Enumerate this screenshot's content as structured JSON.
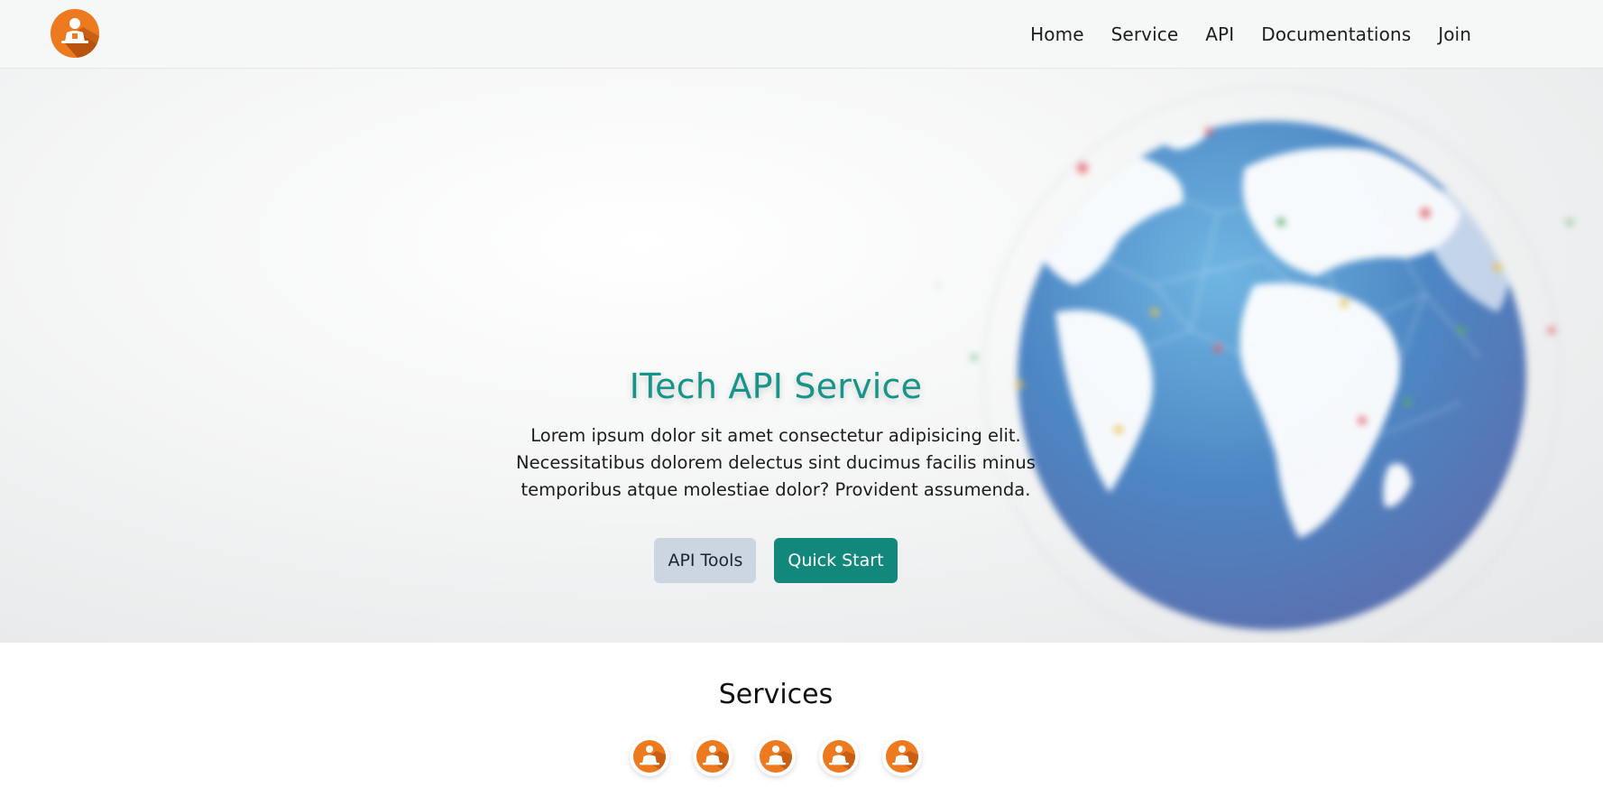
{
  "nav": {
    "logo_icon": "developer-avatar-icon",
    "links": [
      "Home",
      "Service",
      "API",
      "Documentations",
      "Join"
    ]
  },
  "hero": {
    "title": "ITech API Service",
    "description": "Lorem ipsum dolor sit amet consectetur adipisicing elit. Necessitatibus dolorem delectus sint ducimus facilis minus temporibus atque molestiae dolor? Provident assumenda.",
    "buttons": {
      "secondary": "API Tools",
      "primary": "Quick Start"
    },
    "background_icon": "globe-network-icon"
  },
  "services": {
    "title": "Services",
    "icon_name": "developer-avatar-icon",
    "icon_count": 5
  },
  "colors": {
    "accent": "#12877c",
    "title": "#15958a",
    "logo": "#ee7a1f",
    "secondary_button": "#ccd6e2"
  }
}
